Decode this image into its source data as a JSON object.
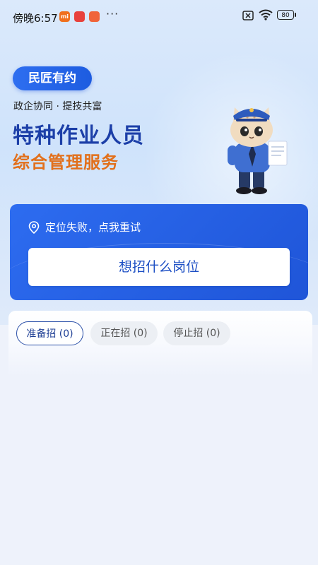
{
  "status_bar": {
    "time": "傍晚6:57",
    "notifications": [
      "mi",
      "app",
      "app"
    ],
    "more": "···",
    "battery": "80"
  },
  "hero": {
    "brand": "民匠有约",
    "slogan": "政企协同 · 提技共富",
    "title": "特种作业人员",
    "subtitle": "综合管理服务"
  },
  "search": {
    "location_text": "定位失败，点我重试",
    "job_button": "想招什么岗位"
  },
  "tabs": [
    {
      "label": "准备招 (0)"
    },
    {
      "label": "正在招 (0)"
    },
    {
      "label": "停止招 (0)"
    }
  ],
  "colors": {
    "brand_blue": "#2d6cf0",
    "title_blue": "#1c3fa8",
    "accent_orange": "#e2701c"
  }
}
